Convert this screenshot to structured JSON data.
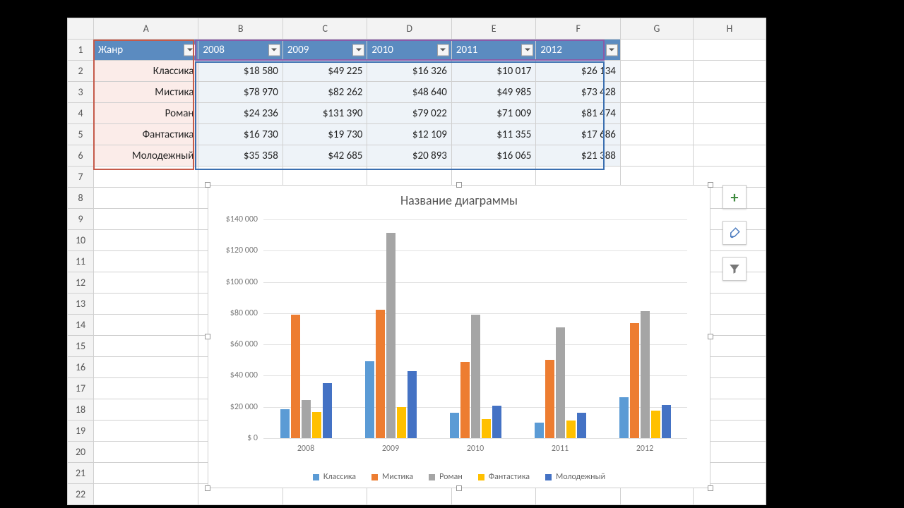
{
  "columns": [
    "A",
    "B",
    "C",
    "D",
    "E",
    "F",
    "G",
    "H"
  ],
  "row_numbers": [
    1,
    2,
    3,
    4,
    5,
    6,
    7,
    8,
    9,
    10,
    11,
    12,
    13,
    14,
    15,
    16,
    17,
    18,
    19,
    20,
    21,
    22
  ],
  "header": {
    "genre_label": "Жанр",
    "years": [
      "2008",
      "2009",
      "2010",
      "2011",
      "2012"
    ]
  },
  "rows": [
    {
      "genre": "Классика",
      "cells": [
        "$18 580",
        "$49 225",
        "$16 326",
        "$10 017",
        "$26 134"
      ]
    },
    {
      "genre": "Мистика",
      "cells": [
        "$78 970",
        "$82 262",
        "$48 640",
        "$49 985",
        "$73 428"
      ]
    },
    {
      "genre": "Роман",
      "cells": [
        "$24 236",
        "$131 390",
        "$79 022",
        "$71 009",
        "$81 474"
      ]
    },
    {
      "genre": "Фантастика",
      "cells": [
        "$16 730",
        "$19 730",
        "$12 109",
        "$11 355",
        "$17 686"
      ]
    },
    {
      "genre": "Молодежный",
      "cells": [
        "$35 358",
        "$42 685",
        "$20 893",
        "$16 065",
        "$21 388"
      ]
    }
  ],
  "chart": {
    "title": "Название диаграммы",
    "yticks": [
      "$140 000",
      "$120 000",
      "$100 000",
      "$80 000",
      "$60 000",
      "$40 000",
      "$20 000",
      "$ 0"
    ]
  },
  "tool_buttons": {
    "plus": "+",
    "brush": "brush-icon",
    "filter": "filter-icon"
  },
  "chart_data": {
    "type": "bar",
    "title": "Название диаграммы",
    "categories": [
      "2008",
      "2009",
      "2010",
      "2011",
      "2012"
    ],
    "series": [
      {
        "name": "Классика",
        "color": "#5b9bd5",
        "values": [
          18580,
          49225,
          16326,
          10017,
          26134
        ]
      },
      {
        "name": "Мистика",
        "color": "#ed7d31",
        "values": [
          78970,
          82262,
          48640,
          49985,
          73428
        ]
      },
      {
        "name": "Роман",
        "color": "#a5a5a5",
        "values": [
          24236,
          131390,
          79022,
          71009,
          81474
        ]
      },
      {
        "name": "Фантастика",
        "color": "#ffc000",
        "values": [
          16730,
          19730,
          12109,
          11355,
          17686
        ]
      },
      {
        "name": "Молодежный",
        "color": "#4472c4",
        "values": [
          35358,
          42685,
          20893,
          16065,
          21388
        ]
      }
    ],
    "ylabel": "",
    "xlabel": "",
    "ylim": [
      0,
      140000
    ],
    "legend_position": "bottom",
    "grid": true
  }
}
